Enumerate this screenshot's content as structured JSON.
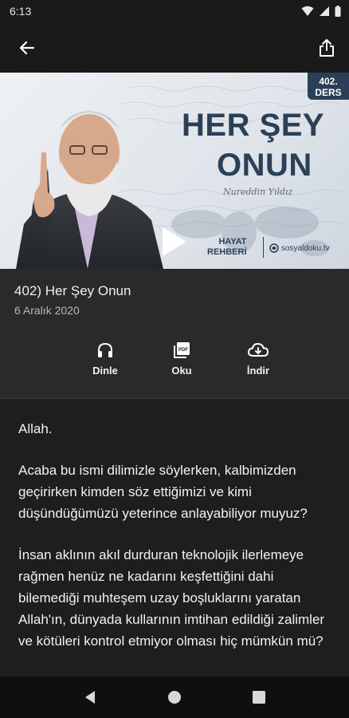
{
  "status_bar": {
    "time": "6:13"
  },
  "app_bar": {
    "back_icon": "arrow-back-icon",
    "share_icon": "share-icon"
  },
  "hero": {
    "badge_line1": "402.",
    "badge_line2": "DERS",
    "title_line1": "HER ŞEY",
    "title_line2": "ONUN",
    "signature": "Nureddin Yıldız",
    "series_line1": "HAYAT",
    "series_line2": "REHBERİ",
    "logo_text": "sosyaldoku.tv"
  },
  "episode": {
    "title": "402) Her Şey Onun",
    "date": "6 Aralık 2020"
  },
  "actions": [
    {
      "label": "Dinle",
      "icon": "headphones-icon"
    },
    {
      "label": "Oku",
      "icon": "pdf-icon"
    },
    {
      "label": "İndir",
      "icon": "cloud-download-icon"
    }
  ],
  "article": {
    "paragraphs": [
      "Allah.",
      "Acaba bu ismi dilimizle söylerken, kalbimizden geçirirken kimden söz ettiğimizi ve kimi düşündüğümüzü yeterince anlayabiliyor muyuz?",
      "İnsan aklının akıl durduran teknolojik ilerlemeye rağmen henüz ne kadarını keşfettiğini dahi bilemediği muhteşem uzay boşluklarını yaratan Allah'ın, dünyada kullarının imtihan edildiği zalimler ve kötüleri kontrol etmiyor olması hiç mümkün mü?"
    ]
  },
  "colors": {
    "background": "#1e1e1e",
    "panel": "#2a2a2a",
    "hero_navy": "#2b3f57"
  }
}
